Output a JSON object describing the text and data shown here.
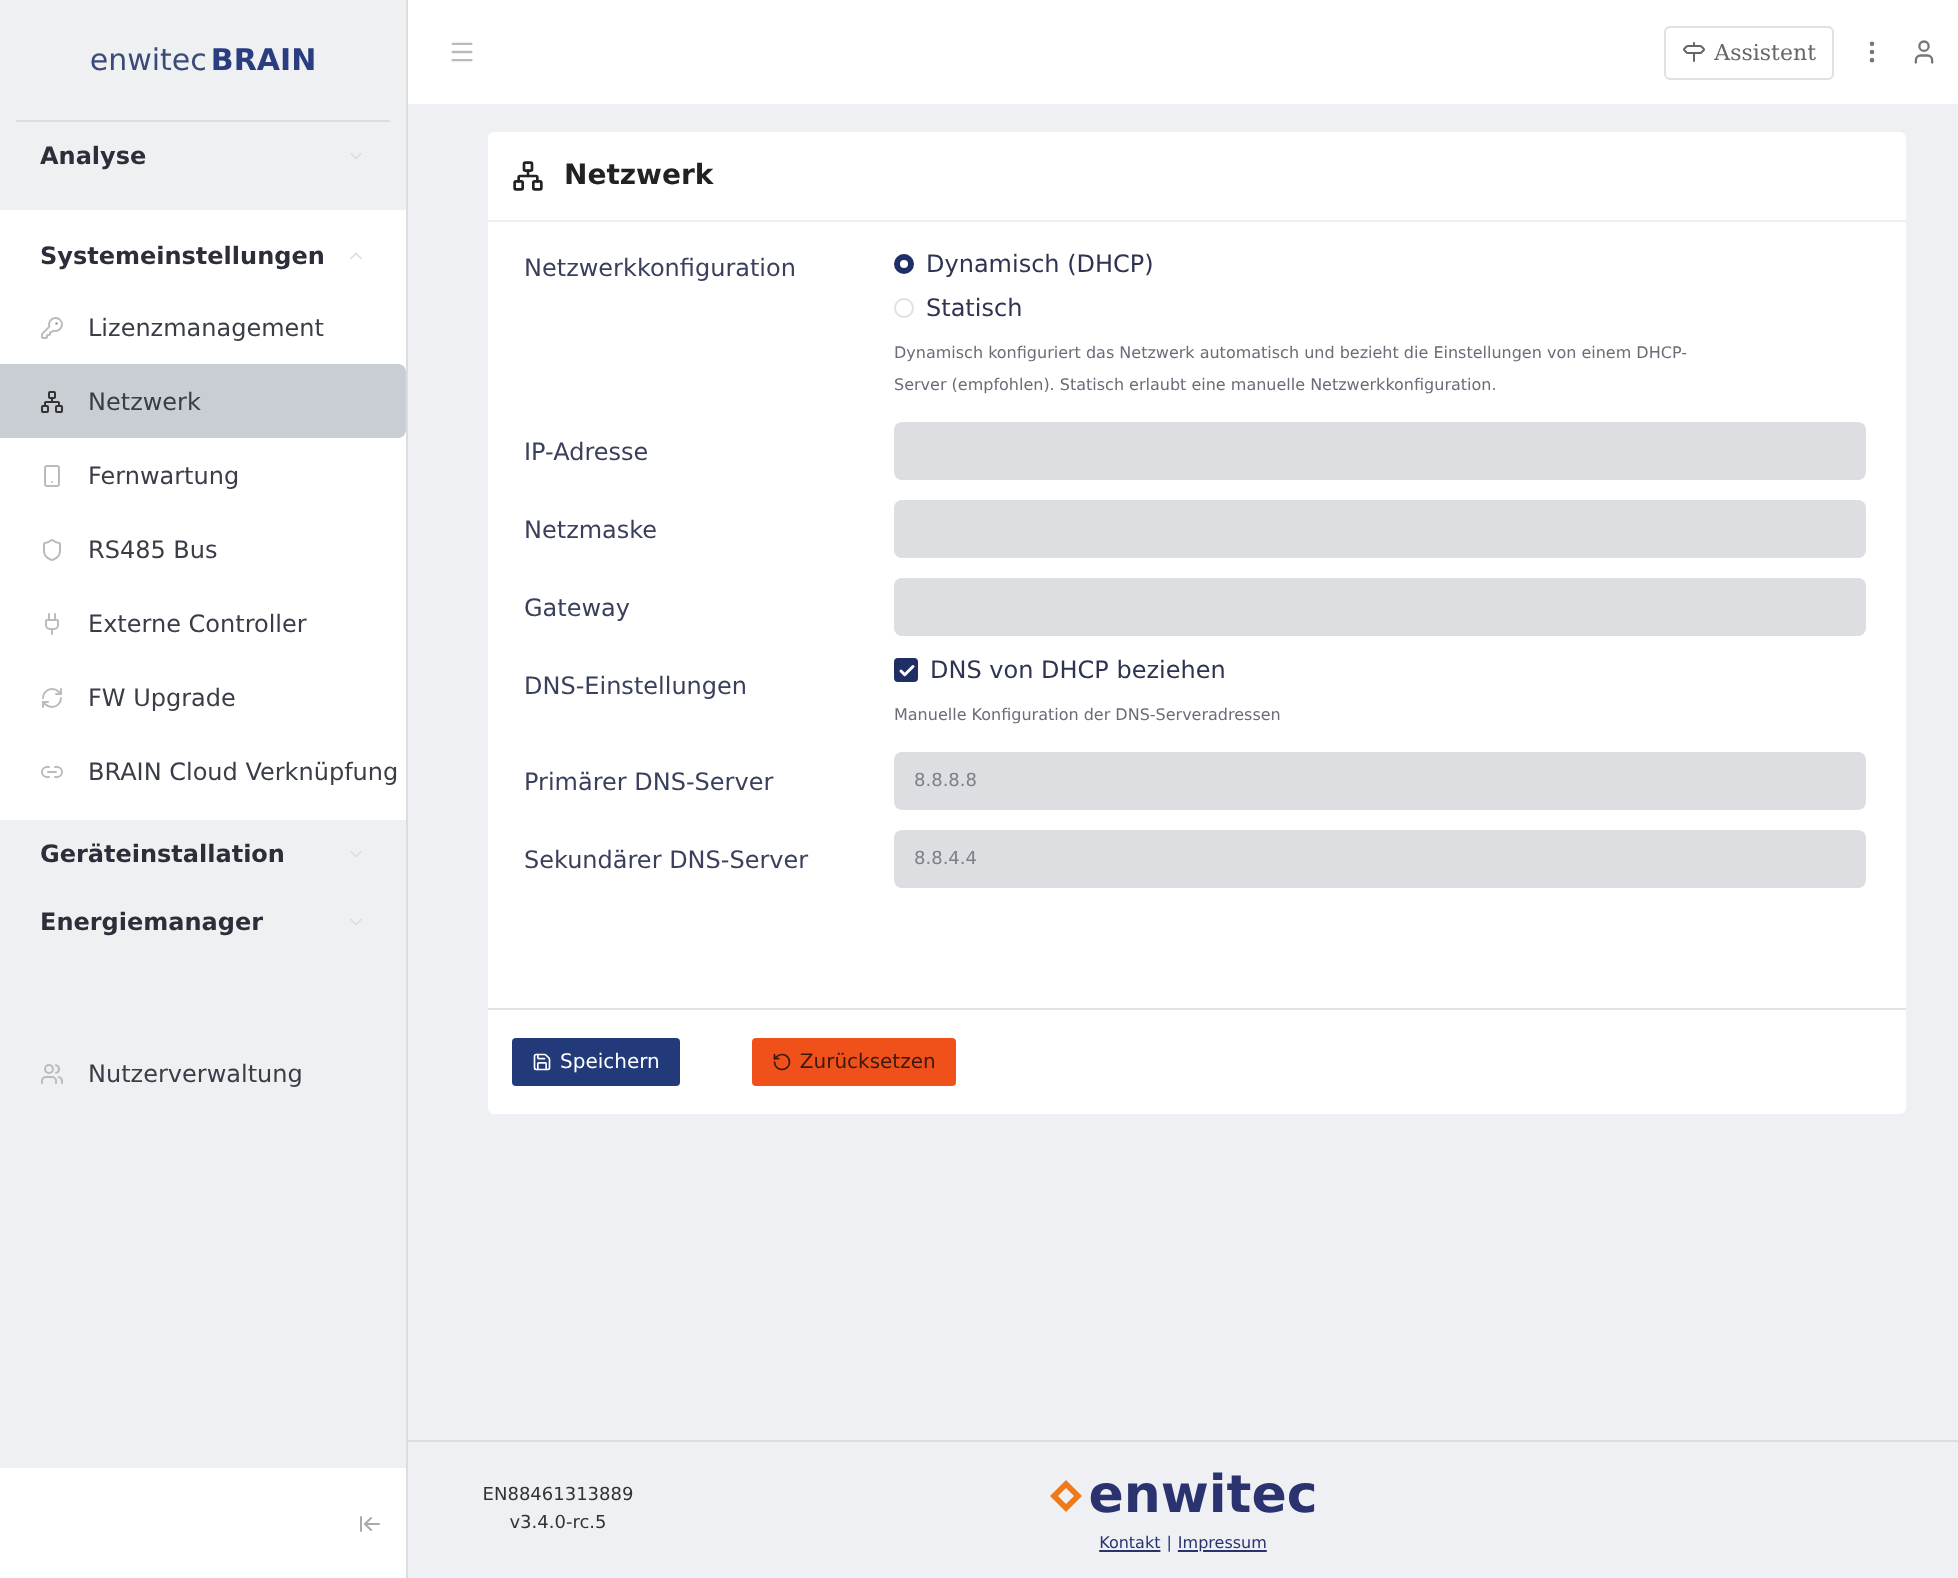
{
  "brand": {
    "name": "enwitec",
    "accent": "BRAIN"
  },
  "sidebar": {
    "groups": [
      {
        "label": "Analyse",
        "expanded": false
      },
      {
        "label": "Systemeinstellungen",
        "expanded": true,
        "items": [
          {
            "label": "Lizenzmanagement",
            "selected": false
          },
          {
            "label": "Netzwerk",
            "selected": true
          },
          {
            "label": "Fernwartung",
            "selected": false
          },
          {
            "label": "RS485 Bus",
            "selected": false
          },
          {
            "label": "Externe Controller",
            "selected": false
          },
          {
            "label": "FW Upgrade",
            "selected": false
          },
          {
            "label": "BRAIN Cloud Verknüpfung",
            "selected": false
          }
        ]
      },
      {
        "label": "Geräteinstallation",
        "expanded": false
      },
      {
        "label": "Energiemanager",
        "expanded": false
      }
    ],
    "extra": [
      {
        "label": "Nutzerverwaltung",
        "selected": false
      }
    ]
  },
  "header": {
    "assistant": "Assistent"
  },
  "card": {
    "title": "Netzwerk",
    "config_label": "Netzwerkkonfiguration",
    "options": [
      {
        "label": "Dynamisch (DHCP)",
        "selected": true
      },
      {
        "label": "Statisch",
        "selected": false
      }
    ],
    "config_help": "Dynamisch konfiguriert das Netzwerk automatisch und bezieht die Einstellungen von einem DHCP-Server (empfohlen). Statisch erlaubt eine manuelle Netzwerkkonfiguration.",
    "fields": [
      {
        "label": "IP-Adresse",
        "disabled": true
      },
      {
        "label": "Netzmaske",
        "disabled": true
      },
      {
        "label": "Gateway",
        "disabled": true
      }
    ],
    "dns_label": "DNS-Einstellungen",
    "dns_checkbox": {
      "label": "DNS von DHCP beziehen",
      "checked": true
    },
    "dns_help": "Manuelle Konfiguration der DNS-Serveradressen",
    "dns_fields": [
      {
        "label": "Primärer DNS-Server",
        "value": "8.8.8.8",
        "disabled": true
      },
      {
        "label": "Sekundärer DNS-Server",
        "value": "8.8.4.4",
        "disabled": true
      }
    ],
    "save": "Speichern",
    "reset": "Zurücksetzen"
  },
  "footer": {
    "serial": "EN88461313889",
    "version": "v3.4.0-rc.5",
    "logo": "enwitec",
    "links": [
      "Kontakt",
      "Impressum"
    ],
    "separator": "|"
  }
}
